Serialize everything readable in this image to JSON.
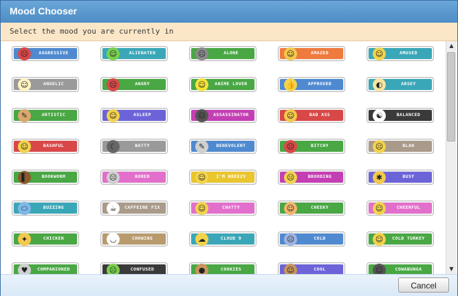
{
  "dialog": {
    "title": "Mood Chooser",
    "instruction": "Select the mood you are currently in",
    "cancel_label": "Cancel"
  },
  "colors": {
    "blue": "#4f8ad0",
    "teal": "#3aa7b8",
    "green": "#49a744",
    "orange": "#ef7a3d",
    "red": "#d94848",
    "purple": "#6d63d8",
    "magenta": "#c43fb3",
    "dark": "#3a3a3a",
    "brown": "#a99a8a",
    "gray": "#9a9a9a",
    "pink": "#e26fcb",
    "yellow": "#e9c52e",
    "tan": "#b89a6d"
  },
  "moods": [
    {
      "label": "AGGRESSIVE",
      "color": "#4f8ad0",
      "icon": "angry-face-icon",
      "glyph": "☹",
      "icon_color": "#d94848"
    },
    {
      "label": "ALIENATED",
      "color": "#3aa7b8",
      "icon": "alien-icon",
      "glyph": "☺",
      "icon_color": "#7ad14e"
    },
    {
      "label": "ALONE",
      "color": "#49a744",
      "icon": "alien-gray-icon",
      "glyph": "☹",
      "icon_color": "#8a8a8a"
    },
    {
      "label": "AMAZED",
      "color": "#ef7a3d",
      "icon": "amazed-face-icon",
      "glyph": "☺",
      "icon_color": "#f2c94c"
    },
    {
      "label": "AMUSED",
      "color": "#3aa7b8",
      "icon": "amused-face-icon",
      "glyph": "☺",
      "icon_color": "#f2d34c"
    },
    {
      "label": "ANGELIC",
      "color": "#9a9a9a",
      "icon": "angel-face-icon",
      "glyph": "☺",
      "icon_color": "#fff4c2"
    },
    {
      "label": "ANGRY",
      "color": "#49a744",
      "icon": "angry-red-face-icon",
      "glyph": "☹",
      "icon_color": "#d94848"
    },
    {
      "label": "ANIME LOVER",
      "color": "#49a744",
      "icon": "anime-face-icon",
      "glyph": "☺",
      "icon_color": "#f6e43a"
    },
    {
      "label": "APPROVED",
      "color": "#4f8ad0",
      "icon": "thumbs-up-icon",
      "glyph": "👍",
      "icon_color": "#f2d34c"
    },
    {
      "label": "ARSEY",
      "color": "#3aa7b8",
      "icon": "arsey-icon",
      "glyph": "◐",
      "icon_color": "#f6e3a0"
    },
    {
      "label": "ARTISTIC",
      "color": "#49a744",
      "icon": "palette-icon",
      "glyph": "✎",
      "icon_color": "#d9a86c"
    },
    {
      "label": "ASLEEP",
      "color": "#6d63d8",
      "icon": "sleeping-face-icon",
      "glyph": "☺",
      "icon_color": "#f2d34c"
    },
    {
      "label": "ASSASSINATOR",
      "color": "#c43fb3",
      "icon": "ninja-face-icon",
      "glyph": "☹",
      "icon_color": "#555555"
    },
    {
      "label": "BAD ASS",
      "color": "#d94848",
      "icon": "sunglasses-gun-icon",
      "glyph": "☺",
      "icon_color": "#f2c94c"
    },
    {
      "label": "BALANCED",
      "color": "#3a3a3a",
      "icon": "yin-yang-icon",
      "glyph": "☯",
      "icon_color": "#ffffff"
    },
    {
      "label": "BASHFUL",
      "color": "#d94848",
      "icon": "bashful-face-icon",
      "glyph": "☺",
      "icon_color": "#f2d34c"
    },
    {
      "label": "BATTY",
      "color": "#9a9a9a",
      "icon": "bat-icon",
      "glyph": "☾",
      "icon_color": "#666666"
    },
    {
      "label": "BENEVOLENT",
      "color": "#4f8ad0",
      "icon": "syringe-icon",
      "glyph": "✎",
      "icon_color": "#cfcfcf"
    },
    {
      "label": "BITCHY",
      "color": "#49a744",
      "icon": "bitchy-faces-icon",
      "glyph": "☹",
      "icon_color": "#d94848"
    },
    {
      "label": "BLAH",
      "color": "#a99a8a",
      "icon": "blah-face-icon",
      "glyph": "☹",
      "icon_color": "#f2d34c"
    },
    {
      "label": "BOOKWORM",
      "color": "#49a744",
      "icon": "book-icon",
      "glyph": "▌",
      "icon_color": "#8b5a2b"
    },
    {
      "label": "BORED",
      "color": "#e26fcb",
      "icon": "bored-face-icon",
      "glyph": "☹",
      "icon_color": "#cfcfcf"
    },
    {
      "label": "I'M BREEZY",
      "color": "#e9c52e",
      "icon": "breezy-face-icon",
      "glyph": "☺",
      "icon_color": "#f2d34c"
    },
    {
      "label": "BROODING",
      "color": "#c43fb3",
      "icon": "brooding-face-icon",
      "glyph": "☹",
      "icon_color": "#f2d34c"
    },
    {
      "label": "BUSY",
      "color": "#6d63d8",
      "icon": "bee-icon",
      "glyph": "✱",
      "icon_color": "#f2c94c"
    },
    {
      "label": "BUZZING",
      "color": "#3aa7b8",
      "icon": "pill-icon",
      "glyph": "⬭",
      "icon_color": "#7fb7e8"
    },
    {
      "label": "CAFFEINE FIX",
      "color": "#a99a8a",
      "icon": "coffee-cup-icon",
      "glyph": "☕",
      "icon_color": "#ffffff"
    },
    {
      "label": "CHATTY",
      "color": "#e26fcb",
      "icon": "chatty-faces-icon",
      "glyph": "☺",
      "icon_color": "#f2d34c"
    },
    {
      "label": "CHEEKY",
      "color": "#49a744",
      "icon": "cheeky-face-icon",
      "glyph": "☺",
      "icon_color": "#f2b56c"
    },
    {
      "label": "CHEERFUL",
      "color": "#e26fcb",
      "icon": "cheerful-face-icon",
      "glyph": "☺",
      "icon_color": "#f2d34c"
    },
    {
      "label": "CHICKEN",
      "color": "#49a744",
      "icon": "chicken-icon",
      "glyph": "✦",
      "icon_color": "#f2c94c"
    },
    {
      "label": "CHOWING",
      "color": "#b89a6d",
      "icon": "bowl-icon",
      "glyph": "◡",
      "icon_color": "#ffffff"
    },
    {
      "label": "CLOUD 9",
      "color": "#3aa7b8",
      "icon": "cloud-face-icon",
      "glyph": "☁",
      "icon_color": "#f2d34c"
    },
    {
      "label": "COLD",
      "color": "#4f8ad0",
      "icon": "cold-face-icon",
      "glyph": "☹",
      "icon_color": "#9fb3e0"
    },
    {
      "label": "COLD TURKEY",
      "color": "#49a744",
      "icon": "cold-turkey-face-icon",
      "glyph": "☺",
      "icon_color": "#f2d34c"
    },
    {
      "label": "COMPANIONED",
      "color": "#49a744",
      "icon": "companioned-icon",
      "glyph": "♥",
      "icon_color": "#cfcfcf"
    },
    {
      "label": "CONFUSED",
      "color": "#3a3a3a",
      "icon": "confused-face-icon",
      "glyph": "☹",
      "icon_color": "#7ad14e"
    },
    {
      "label": "COOKIES",
      "color": "#49a744",
      "icon": "cookie-icon",
      "glyph": "●",
      "icon_color": "#c8955c"
    },
    {
      "label": "COOL",
      "color": "#6d63d8",
      "icon": "cool-face-icon",
      "glyph": "☺",
      "icon_color": "#c8955c"
    },
    {
      "label": "COWABUNGA",
      "color": "#49a744",
      "icon": "turtle-icon",
      "glyph": "☺",
      "icon_color": "#555555"
    }
  ]
}
